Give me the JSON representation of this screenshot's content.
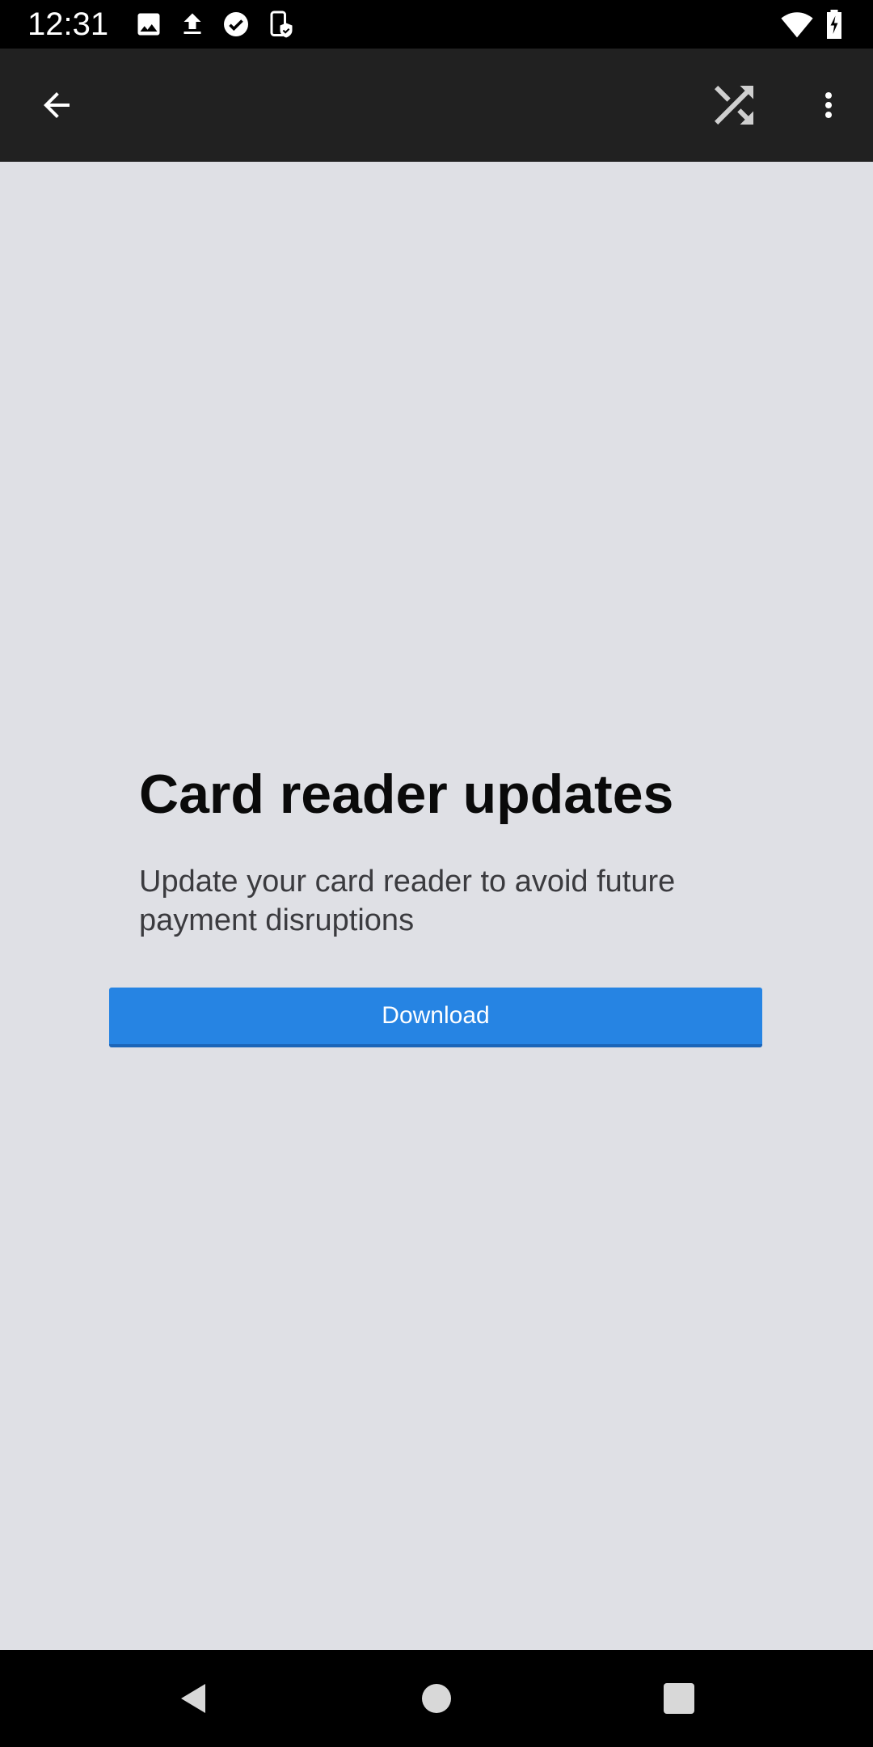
{
  "status_bar": {
    "time": "12:31",
    "left_icons": [
      "image-icon",
      "upload-icon",
      "check-circle-icon",
      "device-shield-icon"
    ],
    "right_icons": [
      "wifi-icon",
      "battery-charging-icon"
    ]
  },
  "toolbar": {
    "background": "#212121",
    "icons": [
      "back-arrow-icon",
      "shuffle-icon",
      "more-vert-icon"
    ]
  },
  "main": {
    "title": "Card reader updates",
    "description": "Update your card reader to avoid future payment disruptions",
    "download_label": "Download",
    "accent_color": "#2684e3"
  },
  "nav_bar": {
    "icons": [
      "nav-back-icon",
      "nav-home-icon",
      "nav-recents-icon"
    ]
  }
}
